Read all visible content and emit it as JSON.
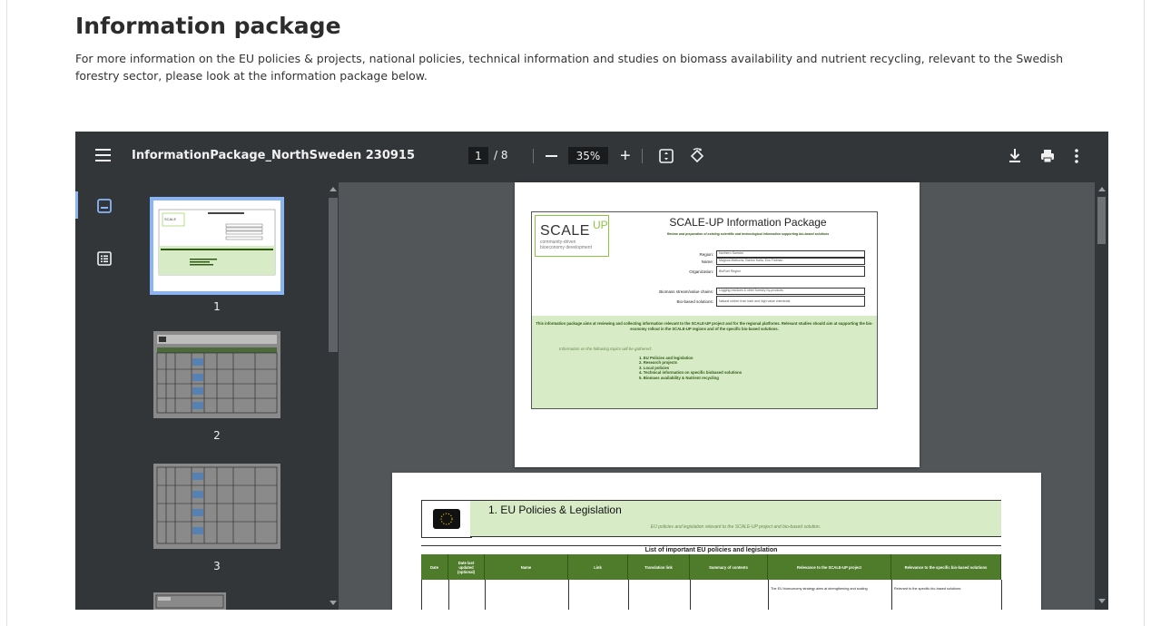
{
  "heading": "Information package",
  "intro": "For more information on the EU policies & projects, national policies, technical information and studies on biomass availability and nutrient recycling, relevant to the Swedish forestry sector, please look at the information package below.",
  "viewer": {
    "file_title": "InformationPackage_NorthSweden 230915",
    "current_page": "1",
    "total_pages": "/ 8",
    "zoom": "35%",
    "icons": {
      "menu": "menu-icon",
      "zoom_out": "minus-icon",
      "zoom_in": "plus-icon",
      "fit": "fit-page-icon",
      "rotate": "rotate-icon",
      "download": "download-icon",
      "print": "print-icon",
      "more": "more-vert-icon",
      "thumbnails_tab": "thumbnails-icon",
      "outline_tab": "outline-icon"
    },
    "thumbnails": [
      {
        "number": "1"
      },
      {
        "number": "2"
      },
      {
        "number": "3"
      }
    ]
  },
  "doc_page1": {
    "logo_main": "SCALE",
    "logo_sup": "UP",
    "logo_tag1": "community-driven",
    "logo_tag2": "bioeconomy development",
    "title": "SCALE-UP Information Package",
    "subtitle": "Review and preparation of existing scientific and technological information supporting bio-based solutions",
    "fields": [
      {
        "label": "Region:",
        "value": "Northern Sweden"
      },
      {
        "label": "Name:",
        "value": "Magnus Matisons, Barbro Kalla, Eva Fridman"
      },
      {
        "label": "Organization:",
        "value": "BioFuel Region"
      },
      {
        "label": "Biomass stream/value chains:",
        "value": "Logging residues & other forestry by-products"
      },
      {
        "label": "Bio-based solutions:",
        "value": "Natural rubber from bark and high value chemicals"
      }
    ],
    "aims": "This information package aims at reviewing and collecting information relevant to the SCALE-UP project and for the regional platforms. Relevant studies should aim at supporting the bio-economy rollout in the SCALE-UP regions and of the specific bio-based solutions.",
    "topics_intro": "Information on the following topics will be gathered:",
    "topics": [
      "1. EU Policies and legislation",
      "2. Research projects",
      "3. Local policies",
      "4. Technical information on specific biobased solutions",
      "5. Biomass availability & Nutrient recycling"
    ]
  },
  "doc_page2": {
    "title": "1. EU Policies & Legislation",
    "subtitle": "EU policies and legislation relevant to the SCALE-UP project and bio-based solution.",
    "table_title": "List of important EU policies and legislation",
    "columns": [
      "Date",
      "Date last updated (optional)",
      "Name",
      "Link",
      "Translation link",
      "Summary of contents",
      "Relevance to the SCALE-UP project",
      "Relevance to the specific bio-based solutions"
    ],
    "row_snippet_1": "The EU bioeconomy strategy aims at strengthening and scaling",
    "row_snippet_2": "Relevant to the specific bio-based solutions:"
  },
  "colors": {
    "toolbar": "#323639",
    "viewer_bg": "#525659",
    "doc_green": "#4f7c2b",
    "light_green": "#d7ebc6",
    "logo_green": "#8cc63f",
    "accent_blue": "#8ab4f8"
  }
}
